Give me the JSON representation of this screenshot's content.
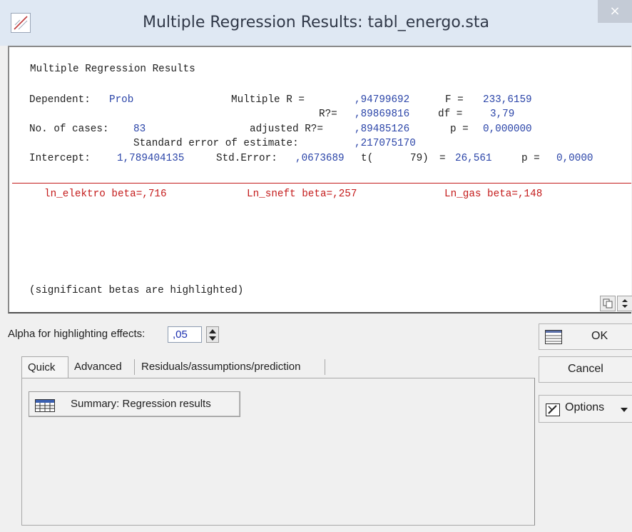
{
  "window": {
    "title": "Multiple Regression Results: tabl_energo.sta",
    "close_glyph": "×"
  },
  "results": {
    "heading": "Multiple Regression Results",
    "dependent_label": "Dependent:",
    "dependent_value": "Prob",
    "multiple_r_label": "Multiple R =",
    "multiple_r_value": ",94799692",
    "f_label": "F =",
    "f_value": "233,6159",
    "r2_label": "R?=",
    "r2_value": ",89869816",
    "df_label": "df =",
    "df_value": "3,79",
    "cases_label": "No. of cases:",
    "cases_value": "83",
    "adj_r2_label": "adjusted R?=",
    "adj_r2_value": ",89485126",
    "p_label": "p =",
    "p_value": "0,000000",
    "se_label": "Standard error of estimate:",
    "se_value": ",217075170",
    "intercept_label": "Intercept:",
    "intercept_value": "1,789404135",
    "stderr_label": "Std.Error:",
    "stderr_value": ",0673689",
    "t_label": "t(",
    "t_df": "79)",
    "t_eq": "=",
    "t_value": "26,561",
    "p2_label": "p =",
    "p2_value": "0,0000",
    "betas": [
      "ln_elektro beta=,716",
      "Ln_sneft beta=,257",
      "Ln_gas beta=,148"
    ],
    "note": "(significant betas are highlighted)"
  },
  "colors": {
    "value": "#2a44a8",
    "highlight": "#c41a1a"
  },
  "alpha": {
    "label": "Alpha for highlighting effects:",
    "value": ",05"
  },
  "tabs": [
    {
      "label": "Quick",
      "active": true
    },
    {
      "label": "Advanced",
      "active": false
    },
    {
      "label": "Residuals/assumptions/prediction",
      "active": false
    }
  ],
  "quick": {
    "summary_label": "Summary:  Regression results"
  },
  "buttons": {
    "ok": "OK",
    "cancel": "Cancel",
    "options": "Options"
  },
  "icons": [
    "app-icon",
    "close-icon",
    "copy-icon",
    "collapse-icon",
    "spin-up-icon",
    "spin-down-icon",
    "summary-table-icon",
    "ok-icon",
    "options-icon",
    "chevron-down-icon"
  ]
}
